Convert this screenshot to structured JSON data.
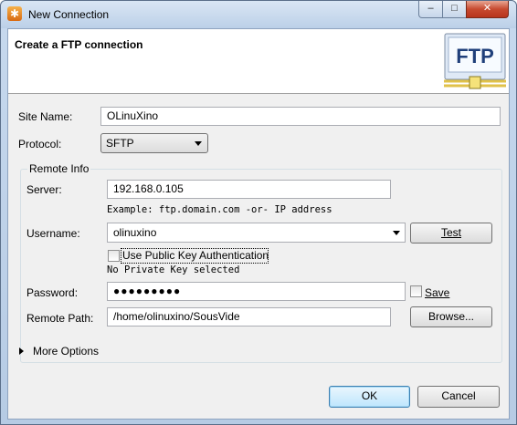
{
  "window": {
    "title": "New Connection",
    "min_glyph": "–",
    "max_glyph": "□",
    "close_glyph": "✕",
    "app_icon_glyph": "✱"
  },
  "header": {
    "title": "Create a FTP connection",
    "logo_text": "FTP"
  },
  "site_name": {
    "label": "Site Name:",
    "value": "OLinuXino"
  },
  "protocol": {
    "label": "Protocol:",
    "value": "SFTP"
  },
  "remote_info": {
    "title": "Remote Info",
    "server": {
      "label": "Server:",
      "value": "192.168.0.105",
      "hint": "Example: ftp.domain.com -or- IP address"
    },
    "username": {
      "label": "Username:",
      "value": "olinuxino",
      "test_button": "Test"
    },
    "public_key": {
      "label": "Use Public Key Authentication",
      "checked": false,
      "status": "No Private Key selected"
    },
    "password": {
      "label": "Password:",
      "masked_value": "●●●●●●●●●",
      "save_label": "Save",
      "save_checked": false
    },
    "remote_path": {
      "label": "Remote Path:",
      "value": "/home/olinuxino/SousVide",
      "browse_button": "Browse..."
    }
  },
  "more_options": {
    "label": "More Options"
  },
  "footer": {
    "ok_button": "OK",
    "cancel_button": "Cancel"
  }
}
